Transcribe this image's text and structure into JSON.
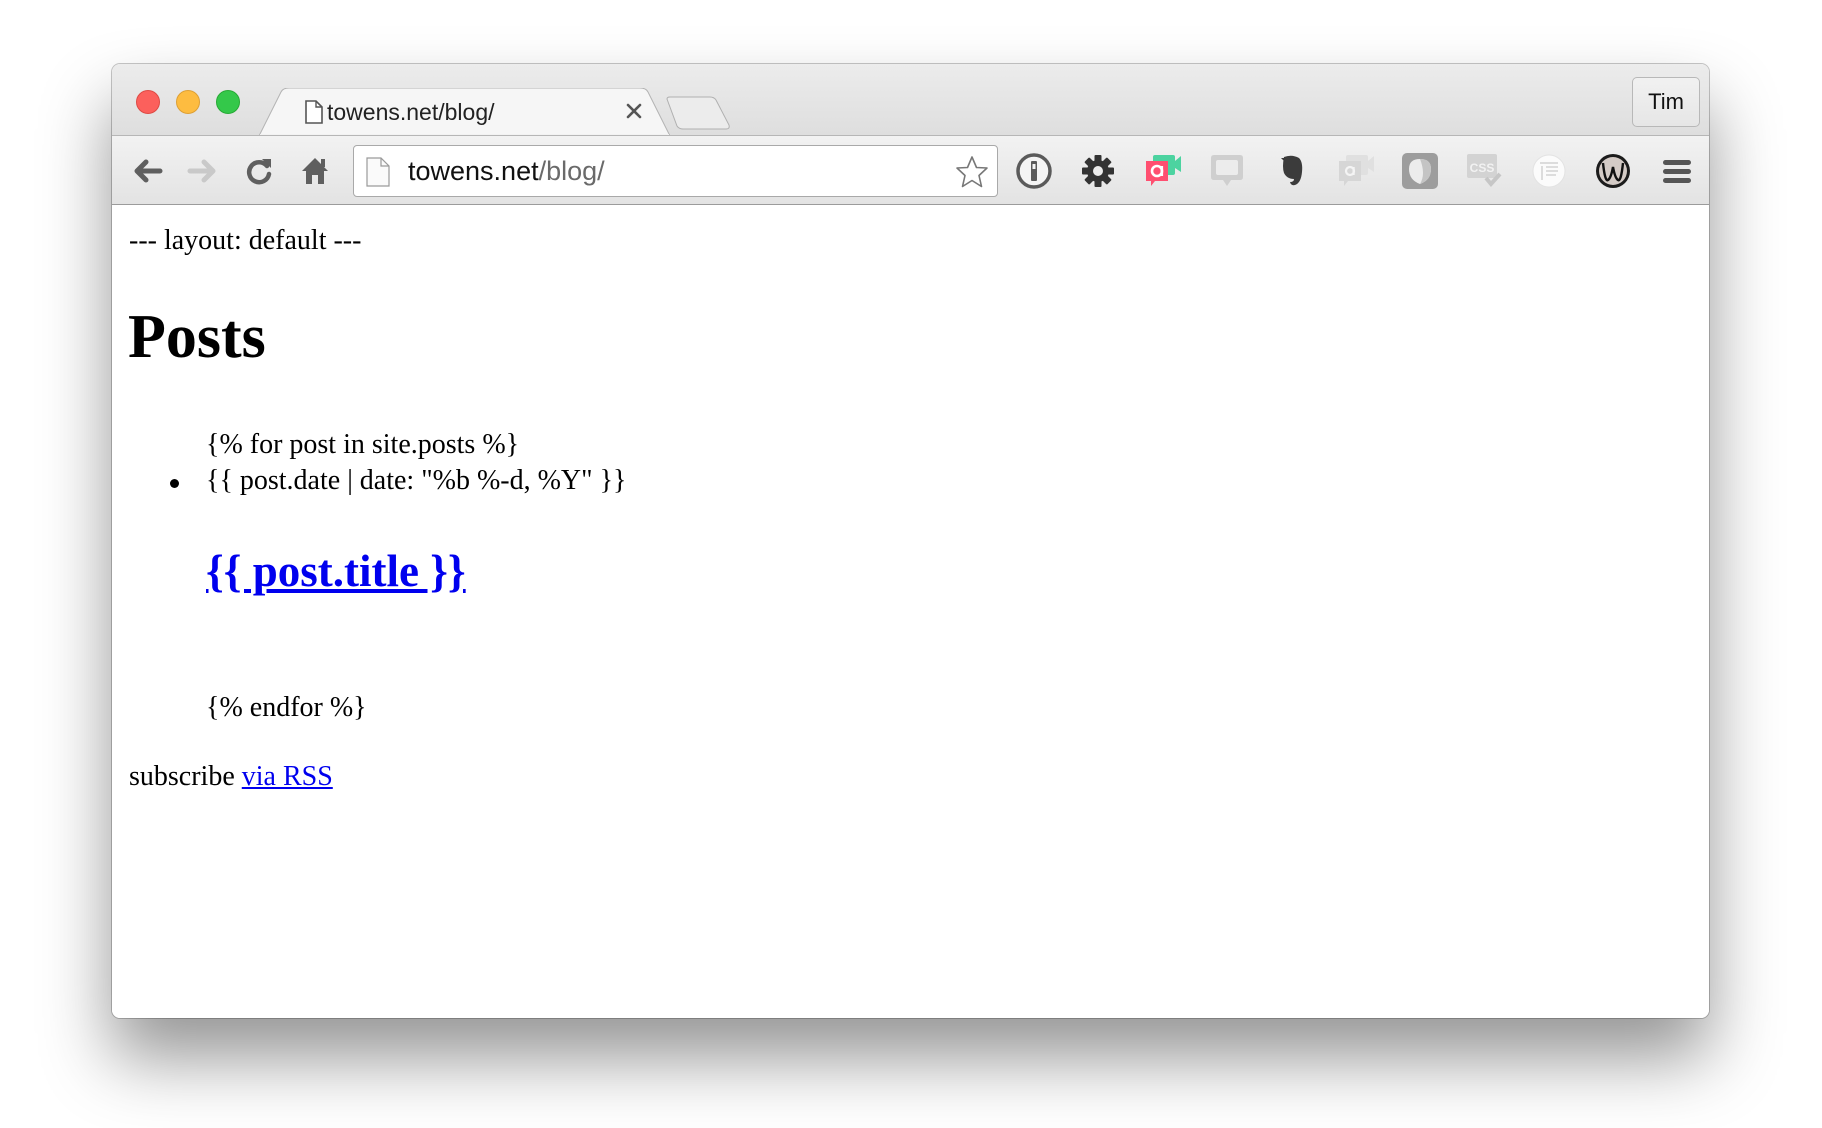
{
  "browser": {
    "tab": {
      "title": "towens.net/blog/",
      "close_label": "×"
    },
    "profile_label": "Tim",
    "omnibox": {
      "host": "towens.net",
      "path": "/blog/"
    },
    "nav": {
      "back": "back-icon",
      "forward": "forward-icon",
      "reload": "reload-icon",
      "home": "home-icon"
    },
    "extensions": [
      {
        "name": "1password-icon"
      },
      {
        "name": "gear-icon"
      },
      {
        "name": "appear-in-icon"
      },
      {
        "name": "chat-bubble-icon"
      },
      {
        "name": "evernote-icon"
      },
      {
        "name": "appear-in-disabled-icon"
      },
      {
        "name": "shield-icon"
      },
      {
        "name": "css-validator-icon"
      },
      {
        "name": "reader-icon"
      },
      {
        "name": "w-circle-icon"
      },
      {
        "name": "menu-icon"
      }
    ],
    "colors": {
      "traffic_red": "#fc605c",
      "traffic_yellow": "#fdbc40",
      "traffic_green": "#34c84a",
      "appear_pink": "#ff4f70",
      "appear_green": "#4cd3a0",
      "link": "#0000ee"
    }
  },
  "page": {
    "front_matter": "--- layout: default ---",
    "heading": "Posts",
    "for_tag": "{% for post in site.posts %}",
    "date_tag": "{{ post.date | date: \"%b %-d, %Y\" }}",
    "post_title": "{{ post.title }}",
    "endfor_tag": "{% endfor %}",
    "subscribe_text": "subscribe ",
    "rss_link": "via RSS"
  }
}
